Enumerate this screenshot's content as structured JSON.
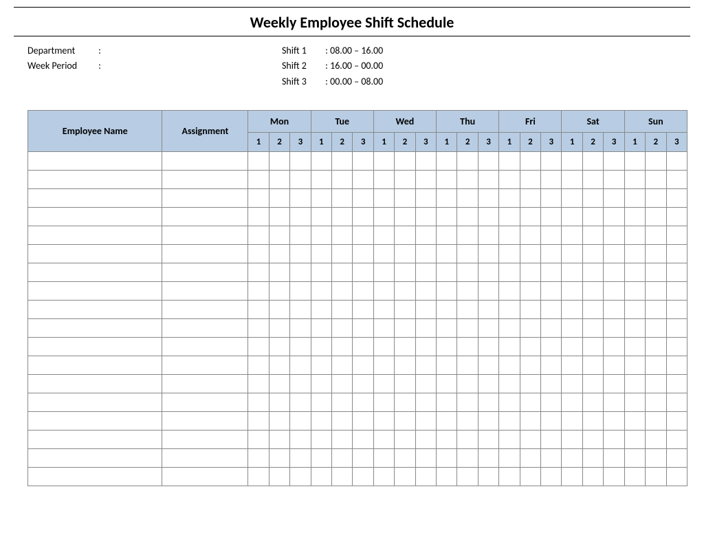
{
  "title": "Weekly Employee Shift Schedule",
  "info": {
    "department_label": "Department",
    "department_sep": ":",
    "department_value": "",
    "week_period_label": "Week  Period",
    "week_period_sep": ":",
    "week_period_value": ""
  },
  "shifts": [
    {
      "label": "Shift 1",
      "sep": ":",
      "times": "08.00  – 16.00"
    },
    {
      "label": "Shift 2",
      "sep": ":",
      "times": "16.00  – 00.00"
    },
    {
      "label": "Shift 3",
      "sep": ":",
      "times": "00.00  – 08.00"
    }
  ],
  "headers": {
    "employee_name": "Employee Name",
    "assignment": "Assignment",
    "days": [
      "Mon",
      "Tue",
      "Wed",
      "Thu",
      "Fri",
      "Sat",
      "Sun"
    ],
    "shift_numbers": [
      "1",
      "2",
      "3"
    ]
  },
  "row_count": 18
}
